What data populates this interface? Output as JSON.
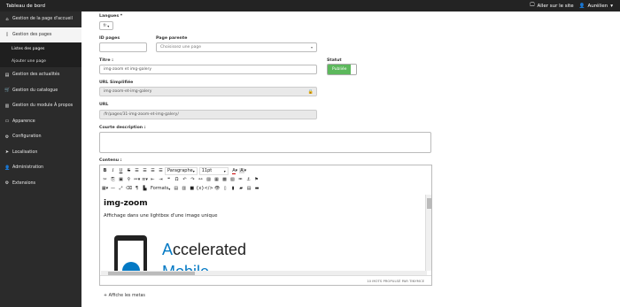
{
  "topbar": {
    "title": "Tableau de bord",
    "site_link": "Aller sur le site",
    "user": "Aurélien"
  },
  "sidebar": {
    "items": [
      {
        "label": "Gestion de la page d'accueil"
      },
      {
        "label": "Gestion des pages"
      },
      {
        "label": "Gestion des actualités"
      },
      {
        "label": "Gestion du catalogue"
      },
      {
        "label": "Gestion du module À propos"
      },
      {
        "label": "Apparence"
      },
      {
        "label": "Configuration"
      },
      {
        "label": "Localisation"
      },
      {
        "label": "Administration"
      },
      {
        "label": "Extensions"
      }
    ],
    "sub_items": [
      {
        "label": "Listes des pages"
      },
      {
        "label": "Ajouter une page"
      }
    ]
  },
  "form": {
    "langue_label": "Langues *",
    "langue_value": "fr",
    "id_label": "ID pages",
    "id_value": "",
    "parent_label": "Page parente",
    "parent_placeholder": "Choisissez une page",
    "titre_label": "Titre :",
    "titre_value": "img-zoom et img-galery",
    "statut_label": "Statut",
    "statut_value": "Publiée",
    "url_simple_label": "URL Simplifiée",
    "url_simple_value": "img-zoom-et-img-galery",
    "url_label": "URL",
    "url_value": "/fr/pages/31-img-zoom-et-img-galery/",
    "desc_label": "Courte description :",
    "contenu_label": "Contenu :",
    "meta_link": "Affiche les metas"
  },
  "editor": {
    "format_label": "Paragraphe",
    "font_size": "11pt",
    "formats_label": "Formats",
    "heading": "img-zoom",
    "paragraph": "Affichage dans une lightbox d'une image unique",
    "logo_text_1": "Accelerated",
    "logo_text_2": "Mobile",
    "status": "10 MOTS PROPULSÉ PAR TINYMCE"
  },
  "colors": {
    "sidebar_bg": "#2b2b2b",
    "topbar_bg": "#232323",
    "status_green": "#5cb85c",
    "amp_blue": "#0379c4"
  }
}
